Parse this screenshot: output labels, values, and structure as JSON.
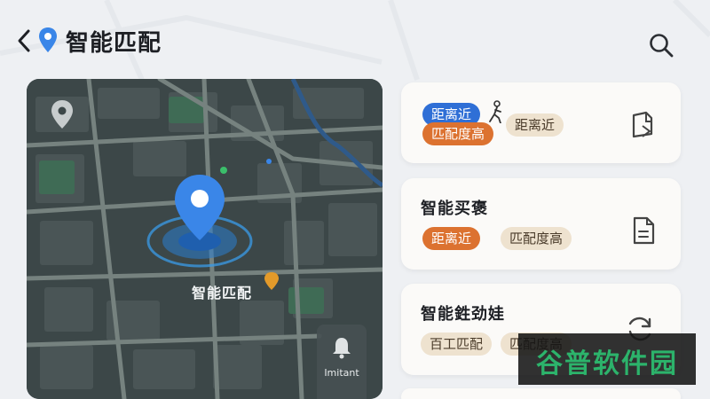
{
  "header": {
    "title": "智能匹配"
  },
  "map": {
    "center_label": "智能匹配",
    "bell_label": "Imitant"
  },
  "cards": [
    {
      "title": "",
      "tags": [
        "距离近",
        "匹配度高",
        "距离近"
      ],
      "action_icon": "door-exit-icon"
    },
    {
      "title": "智能买褒",
      "tags": [
        "距离近",
        "匹配度高"
      ],
      "action_icon": "document-icon"
    },
    {
      "title": "智能鉎劲娃",
      "tags": [
        "百工匹配",
        "匹配度高"
      ],
      "action_icon": "refresh-icon"
    }
  ],
  "watermark": {
    "text": "谷普软件园"
  },
  "colors": {
    "tag_blue": "#2f6fd6",
    "tag_orange": "#dc7230",
    "tag_beige": "#eee2cf",
    "pin_blue": "#3a86e8",
    "map_bg": "#3e4a4b",
    "watermark_green": "#2cb36b"
  }
}
